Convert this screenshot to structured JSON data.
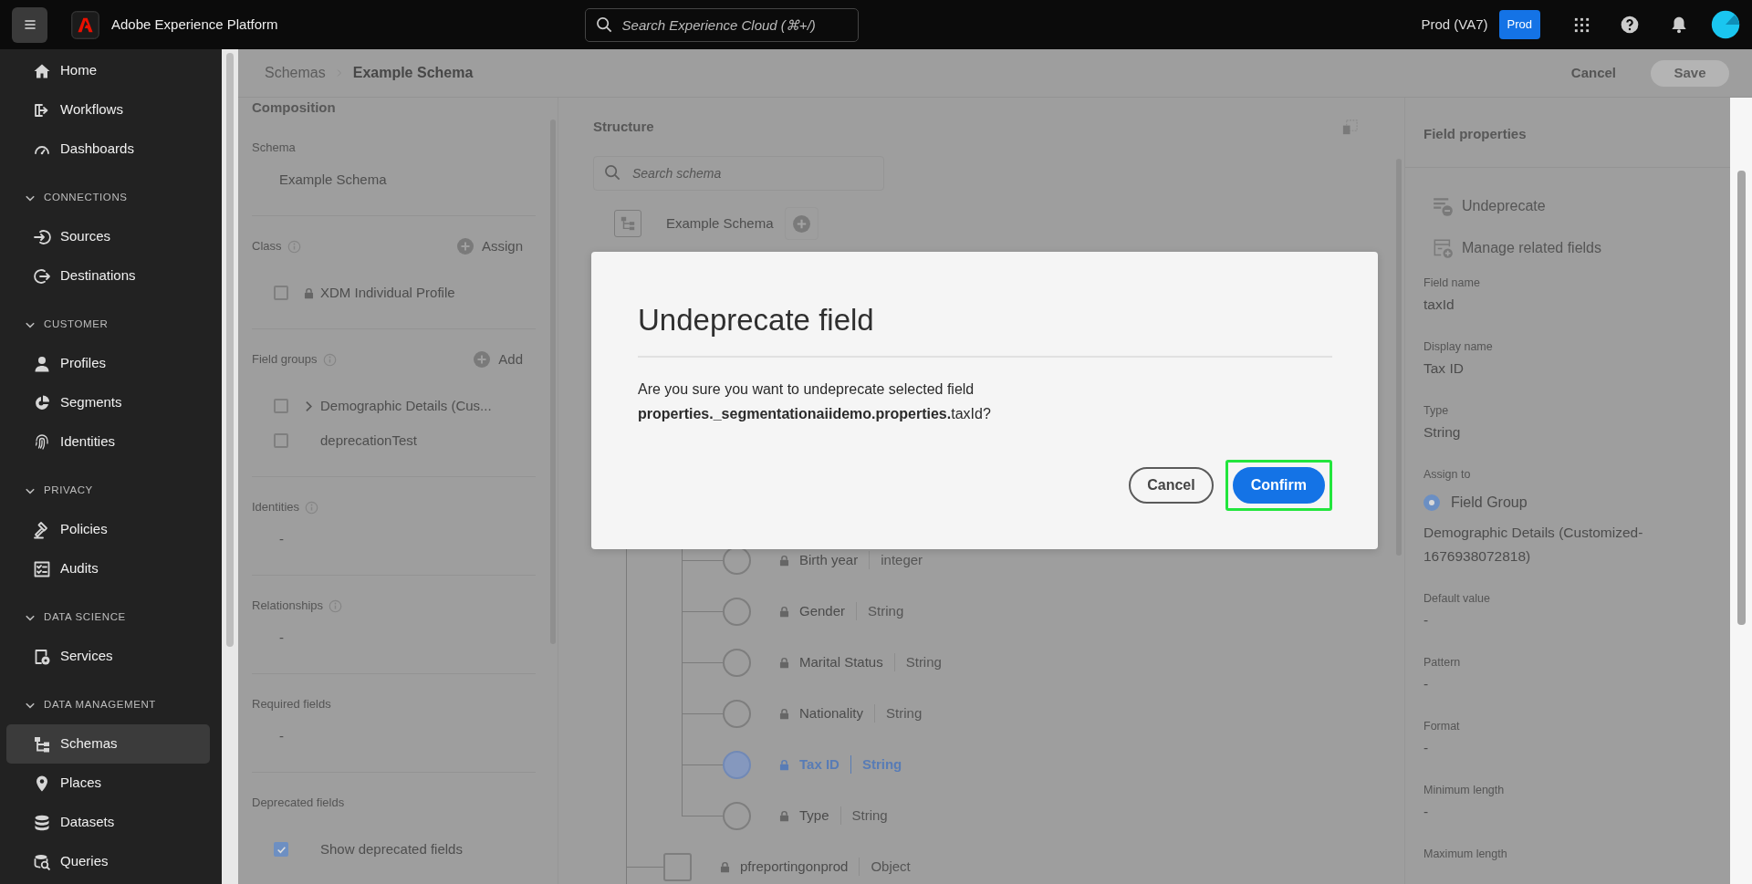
{
  "top_bar": {
    "app_name": "Adobe Experience Platform",
    "search": {
      "placeholder": "Search Experience Cloud (⌘+/)"
    },
    "org": "Prod (VA7)",
    "sandbox_button": "Prod"
  },
  "sidebar": {
    "items": [
      {
        "label": "Home",
        "selected": false
      },
      {
        "label": "Workflows",
        "selected": false
      },
      {
        "label": "Dashboards",
        "selected": false
      }
    ],
    "sections": [
      {
        "title": "CONNECTIONS",
        "expanded": true,
        "items": [
          {
            "label": "Sources",
            "selected": false
          },
          {
            "label": "Destinations",
            "selected": false
          }
        ]
      },
      {
        "title": "CUSTOMER",
        "expanded": true,
        "items": [
          {
            "label": "Profiles",
            "selected": false
          },
          {
            "label": "Segments",
            "selected": false
          },
          {
            "label": "Identities",
            "selected": false
          }
        ]
      },
      {
        "title": "PRIVACY",
        "expanded": true,
        "items": [
          {
            "label": "Policies",
            "selected": false
          },
          {
            "label": "Audits",
            "selected": false
          }
        ]
      },
      {
        "title": "DATA SCIENCE",
        "expanded": true,
        "items": [
          {
            "label": "Services",
            "selected": false
          }
        ]
      },
      {
        "title": "DATA MANAGEMENT",
        "expanded": true,
        "items": [
          {
            "label": "Schemas",
            "selected": true
          },
          {
            "label": "Places",
            "selected": false
          },
          {
            "label": "Datasets",
            "selected": false
          },
          {
            "label": "Queries",
            "selected": false
          }
        ]
      }
    ]
  },
  "breadcrumb": [
    {
      "label": "Schemas",
      "current": false
    },
    {
      "label": "Example Schema",
      "current": true
    }
  ],
  "header_actions": {
    "cancel": "Cancel",
    "save": {
      "label": "Save",
      "disabled": true
    }
  },
  "composition": {
    "title": "Composition",
    "sections": [
      {
        "label": "Schema",
        "info": false,
        "value": "Example Schema"
      },
      {
        "label": "Class",
        "info": true,
        "action": "Assign",
        "items": [
          {
            "label": "XDM Individual Profile",
            "checked": false,
            "locked": true,
            "expandable": false
          }
        ]
      },
      {
        "label": "Field groups",
        "info": true,
        "action": "Add",
        "items": [
          {
            "label": "Demographic Details (Cus...",
            "checked": false,
            "locked": false,
            "expandable": true
          },
          {
            "label": "deprecationTest",
            "checked": false,
            "locked": false,
            "expandable": false
          }
        ]
      },
      {
        "label": "Identities",
        "info": true,
        "value": "-"
      },
      {
        "label": "Relationships",
        "info": true,
        "value": "-"
      },
      {
        "label": "Required fields",
        "info": false,
        "value": "-"
      },
      {
        "label": "Deprecated fields",
        "info": false,
        "items": [
          {
            "label": "Show deprecated fields",
            "checked": true,
            "locked": false,
            "expandable": false
          }
        ]
      }
    ]
  },
  "structure": {
    "title": "Structure",
    "search": {
      "placeholder": "Search schema"
    },
    "tree": {
      "label": "Example Schema",
      "children": [
        {
          "children": [
            {
              "kind": "field",
              "label": "Birth year",
              "type": "integer",
              "locked": true,
              "selected": false
            },
            {
              "kind": "field",
              "label": "Gender",
              "type": "String",
              "locked": true,
              "selected": false
            },
            {
              "kind": "field",
              "label": "Marital Status",
              "type": "String",
              "locked": true,
              "selected": false
            },
            {
              "kind": "field",
              "label": "Nationality",
              "type": "String",
              "locked": true,
              "selected": false
            },
            {
              "kind": "field",
              "label": "Tax ID",
              "type": "String",
              "locked": true,
              "selected": true
            },
            {
              "kind": "field",
              "label": "Type",
              "type": "String",
              "locked": true,
              "selected": false
            }
          ]
        },
        {
          "kind": "object",
          "label": "pfreportingonprod",
          "type": "Object",
          "locked": true,
          "selected": false
        }
      ]
    }
  },
  "field_properties": {
    "title": "Field properties",
    "actions": [
      {
        "label": "Undeprecate",
        "kind": "undeprecate"
      },
      {
        "label": "Manage related fields",
        "kind": "manage"
      }
    ],
    "properties": [
      {
        "kind": "text",
        "label": "Field name",
        "value": "taxId"
      },
      {
        "kind": "text",
        "label": "Display name",
        "value": "Tax ID"
      },
      {
        "kind": "text",
        "label": "Type",
        "value": "String"
      },
      {
        "kind": "radio",
        "label": "Assign to",
        "options": [
          {
            "label": "Field Group",
            "selected": true
          }
        ],
        "value": "Demographic Details (Customized-1676938072818)"
      },
      {
        "kind": "text",
        "label": "Default value",
        "value": "-"
      },
      {
        "kind": "text",
        "label": "Pattern",
        "value": "-"
      },
      {
        "kind": "text",
        "label": "Format",
        "value": "-"
      },
      {
        "kind": "text",
        "label": "Minimum length",
        "value": "-"
      },
      {
        "kind": "text",
        "label": "Maximum length"
      }
    ]
  },
  "dialog": {
    "title": "Undeprecate field",
    "message": "Are you sure you want to undeprecate selected field\n**properties._segmentationaiidemo.properties.**taxId?",
    "buttons": [
      {
        "label": "Cancel",
        "kind": "secondary",
        "highlighted": false
      },
      {
        "label": "Confirm",
        "kind": "primary",
        "highlighted": true
      }
    ]
  }
}
